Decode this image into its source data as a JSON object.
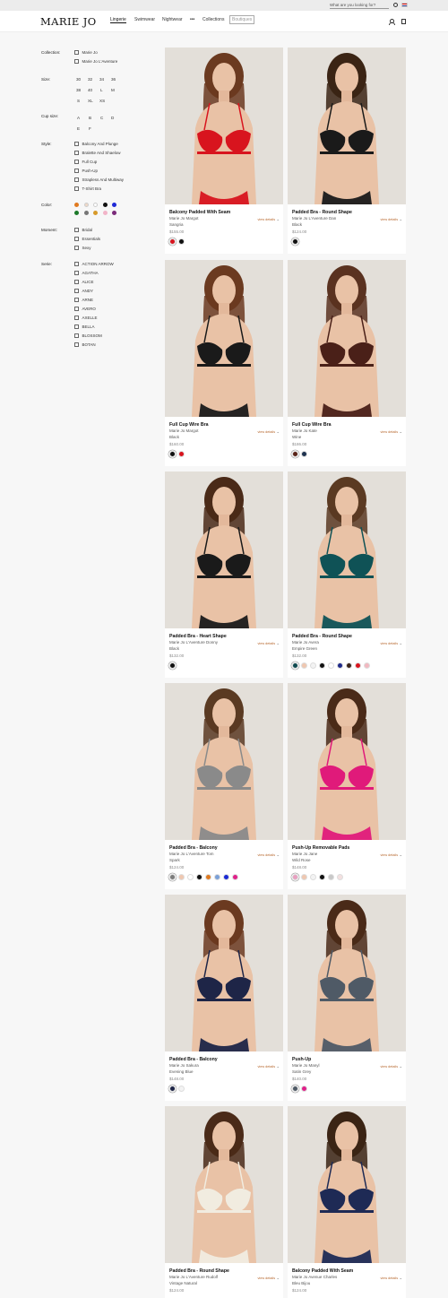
{
  "topbar": {
    "search_placeholder": "What are you looking for?"
  },
  "header": {
    "logo": "MARIE JO",
    "nav": [
      "Lingerie",
      "Swimwear",
      "Nightwear",
      "Collections",
      "Boutiques"
    ],
    "nav_extra_icon": "more-icon"
  },
  "filters": {
    "collection": {
      "title": "Collection:",
      "options": [
        "Marie Jo",
        "Marie Jo L'Aventure"
      ]
    },
    "size": {
      "title": "Size:",
      "options": [
        "30",
        "32",
        "34",
        "36",
        "38",
        "40",
        "L",
        "M",
        "S",
        "XL",
        "XS"
      ]
    },
    "cup": {
      "title": "Cup size:",
      "options": [
        "A",
        "B",
        "C",
        "D",
        "E",
        "F"
      ]
    },
    "style": {
      "title": "Style:",
      "options": [
        "Balcony And Plunge",
        "Bralette And Shaelow",
        "Full Cup",
        "Push-Up",
        "Strapless And Multiway",
        "T-Shirt Bra"
      ]
    },
    "color": {
      "title": "Color:",
      "colors": [
        "#e07a20",
        "#f0d9c8",
        "#ffffff",
        "#111111",
        "#1f2ad6",
        "#1d7a2a",
        "#777777",
        "#d79a2a",
        "#f2b4c8",
        "#7b2a7a"
      ]
    },
    "moment": {
      "title": "Moment:",
      "options": [
        "Bridal",
        "Essentials",
        "Sexy"
      ]
    },
    "serie": {
      "title": "Serie:",
      "options": [
        "ACTION ARROW",
        "AGATHA",
        "ALICE",
        "ANDY",
        "ARNE",
        "AVERO",
        "AXELLE",
        "BELLA",
        "BLOSSOM",
        "BOTAN"
      ]
    }
  },
  "products": [
    {
      "title": "Balcony Padded With Seam",
      "collection": "Marie Jo Margot",
      "color": "Sangria",
      "price": "$155.00",
      "details": "view details",
      "bra": "#d8141e",
      "hair": "#6b3a20",
      "swatches": [
        "#d8141e",
        "#111111"
      ]
    },
    {
      "title": "Padded Bra - Round Shape",
      "collection": "Marie Jo L'Aventure Dan",
      "color": "Black",
      "price": "$124.00",
      "details": "view details",
      "bra": "#1a1a1a",
      "hair": "#3b2414",
      "swatches": [
        "#111111"
      ]
    },
    {
      "title": "Full Cup Wire Bra",
      "collection": "Marie Jo Margot",
      "color": "Black",
      "price": "$160.00",
      "details": "view details",
      "bra": "#1a1a1a",
      "hair": "#6b3a20",
      "swatches": [
        "#111111",
        "#d8141e"
      ]
    },
    {
      "title": "Full Cup Wire Bra",
      "collection": "Marie Jo Kate",
      "color": "Wine",
      "price": "$186.00",
      "details": "view details",
      "bra": "#4a2018",
      "hair": "#5a3220",
      "swatches": [
        "#5a2418",
        "#1f3350"
      ]
    },
    {
      "title": "Padded Bra - Heart Shape",
      "collection": "Marie Jo L'Aventure Donny",
      "color": "Black",
      "price": "$132.00",
      "details": "view details",
      "bra": "#1a1a1a",
      "hair": "#4a2a18",
      "swatches": [
        "#111111"
      ]
    },
    {
      "title": "Padded Bra - Round Shape",
      "collection": "Marie Jo Avera",
      "color": "Empire Green",
      "price": "$132.00",
      "details": "view details",
      "bra": "#0f5256",
      "hair": "#5b3a22",
      "swatches": [
        "#0f4a50",
        "#efc7b0",
        "#f3f3f3",
        "#111111",
        "#ffffff",
        "#1f2a8a",
        "#3a2418",
        "#d8141e",
        "#f2b8c0"
      ]
    },
    {
      "title": "Padded Bra - Balcony",
      "collection": "Marie Jo L'Aventure Tom",
      "color": "Spark",
      "price": "$124.00",
      "details": "view details",
      "bra": "#8a8a8a",
      "hair": "#5a3a22",
      "swatches": [
        "#7d7d7d",
        "#efc7b0",
        "#ffffff",
        "#111111",
        "#e07a20",
        "#7aa0d8",
        "#1a2ad6",
        "#e0208a"
      ]
    },
    {
      "title": "Push-Up Removable Pads",
      "collection": "Marie Jo Jane",
      "color": "Wild Rose",
      "price": "$148.00",
      "details": "view details",
      "bra": "#e01a7a",
      "hair": "#4a2a18",
      "swatches": [
        "#e8a0c0",
        "#efc7b0",
        "#f3f3f3",
        "#111111",
        "#c8c8c8",
        "#f3e0e0"
      ]
    },
    {
      "title": "Padded Bra - Balcony",
      "collection": "Marie Jo Sakura",
      "color": "Evening Blue",
      "price": "$148.00",
      "details": "view details",
      "bra": "#1e2547",
      "hair": "#6b3a20",
      "swatches": [
        "#1e2547",
        "#f3f3f3"
      ]
    },
    {
      "title": "Push-Up",
      "collection": "Marie Jo Manyl",
      "color": "Satin Grey",
      "price": "$140.00",
      "details": "view details",
      "bra": "#4f5a66",
      "hair": "#4a2a18",
      "swatches": [
        "#4f5a66",
        "#e0208a"
      ]
    },
    {
      "title": "Padded Bra - Round Shape",
      "collection": "Marie Jo L'Aventure Rudolf",
      "color": "Vintage Natural",
      "price": "$124.00",
      "details": "view details",
      "bra": "#f1ece0",
      "hair": "#4a2a18",
      "swatches": []
    },
    {
      "title": "Balcony Padded With Seam",
      "collection": "Marie Jo Avenue Charles",
      "color": "Bleu Bijou",
      "price": "$124.00",
      "details": "view details",
      "bra": "#1e2a55",
      "hair": "#3b2414",
      "swatches": []
    }
  ]
}
